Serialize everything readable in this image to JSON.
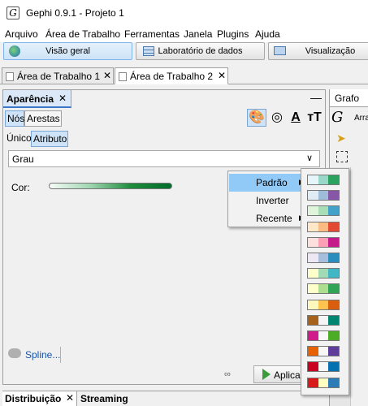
{
  "window": {
    "title": "Gephi 0.9.1 - Projeto 1"
  },
  "menu": [
    "Arquivo",
    "Área de Trabalho",
    "Ferramentas",
    "Janela",
    "Plugins",
    "Ajuda"
  ],
  "workspace_buttons": {
    "overview": "Visão geral",
    "data_lab": "Laboratório de dados",
    "preview": "Visualização"
  },
  "workspace_tabs": [
    "Área de Trabalho 1",
    "Área de Trabalho 2"
  ],
  "appearance": {
    "title": "Aparência",
    "element_tabs": [
      "Nós",
      "Arestas"
    ],
    "mode_tabs": [
      "Único",
      "Atributo"
    ],
    "attribute": "Grau",
    "color_label": "Cor:",
    "spline_link": "Spline...",
    "apply_label": "Aplicar"
  },
  "bottom_tabs": [
    "Distribuição",
    "Streaming"
  ],
  "graph_panel": {
    "title": "Grafo",
    "arrange_label": "Arra"
  },
  "context_menu": [
    "Padrão",
    "Inverter",
    "Recente"
  ],
  "palettes": [
    [
      "#e5f5f9",
      "#99d8c9",
      "#2ca25f"
    ],
    [
      "#e0ecf4",
      "#9ebcda",
      "#8856a7"
    ],
    [
      "#e0f3db",
      "#a8ddb5",
      "#43a2ca"
    ],
    [
      "#fee8c8",
      "#fdbb84",
      "#e34a33"
    ],
    [
      "#fde0dd",
      "#fa9fb5",
      "#c51b8a"
    ],
    [
      "#ece7f2",
      "#a6bddb",
      "#2b8cbe"
    ],
    [
      "#ffffcc",
      "#a1dab4",
      "#41b6c4"
    ],
    [
      "#ffffcc",
      "#addd8e",
      "#31a354"
    ],
    [
      "#fff7bc",
      "#fec44f",
      "#d95f0e"
    ],
    [
      "#a6611a",
      "#f5f5f5",
      "#018571"
    ],
    [
      "#d01c8b",
      "#f7f7f7",
      "#4dac26"
    ],
    [
      "#e66101",
      "#f7f7f7",
      "#5e3c99"
    ],
    [
      "#ca0020",
      "#f7f7f7",
      "#0571b0"
    ],
    [
      "#d7191c",
      "#ffffbf",
      "#2c7bb6"
    ]
  ]
}
